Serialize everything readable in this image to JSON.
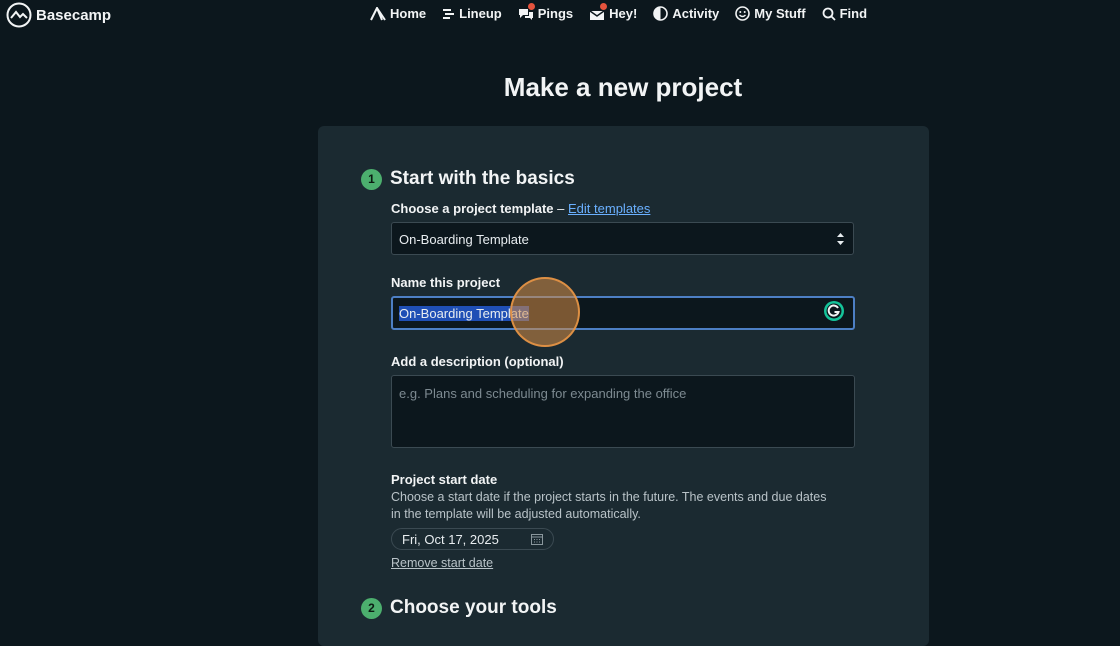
{
  "app": {
    "name": "Basecamp"
  },
  "nav": {
    "items": [
      {
        "label": "Home"
      },
      {
        "label": "Lineup"
      },
      {
        "label": "Pings"
      },
      {
        "label": "Hey!"
      },
      {
        "label": "Activity"
      },
      {
        "label": "My Stuff"
      },
      {
        "label": "Find"
      }
    ]
  },
  "page": {
    "title": "Make a new project"
  },
  "step1": {
    "number": "1",
    "title": "Start with the basics",
    "template_label": "Choose a project template",
    "template_sep": " – ",
    "edit_templates": "Edit templates",
    "template_value": "On-Boarding Template",
    "name_label": "Name this project",
    "name_selected": "On-Boarding Template",
    "description_label": "Add a description (optional)",
    "description_placeholder": "e.g. Plans and scheduling for expanding the office",
    "start_date_label": "Project start date",
    "start_date_help": "Choose a start date if the project starts in the future. The events and due dates in the template will be adjusted automatically.",
    "start_date_value": "Fri, Oct 17, 2025",
    "remove_start_date": "Remove start date"
  },
  "step2": {
    "number": "2",
    "title": "Choose your tools"
  },
  "colors": {
    "background": "#0c171d",
    "card": "#1b2a31",
    "accent_green": "#4caf6e",
    "link": "#6ab0ff",
    "selection": "#1f4fb5"
  }
}
